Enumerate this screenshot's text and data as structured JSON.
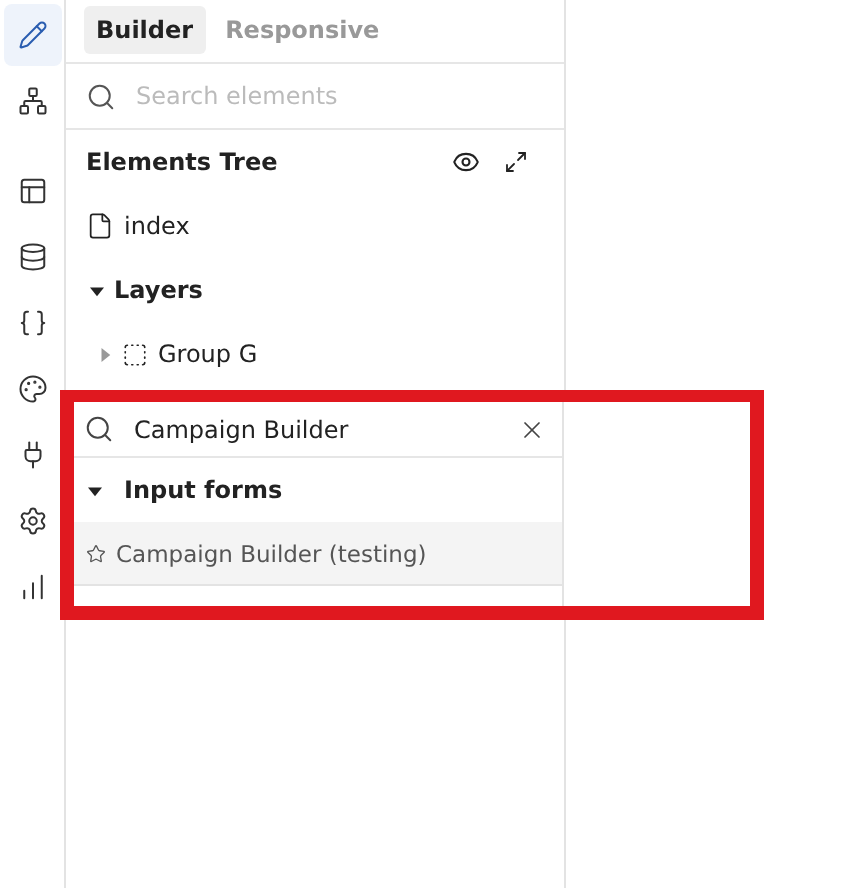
{
  "rail": [
    {
      "kind": "pencil",
      "selected": true
    },
    {
      "kind": "sitemap",
      "selected": false
    },
    {
      "kind": "layout",
      "selected": false
    },
    {
      "kind": "database",
      "selected": false
    },
    {
      "kind": "braces",
      "selected": false
    },
    {
      "kind": "palette",
      "selected": false
    },
    {
      "kind": "plug",
      "selected": false
    },
    {
      "kind": "settings",
      "selected": false
    },
    {
      "kind": "chart",
      "selected": false
    }
  ],
  "tabs": [
    {
      "label": "Builder",
      "selected": true
    },
    {
      "label": "Responsive",
      "selected": false
    }
  ],
  "search": {
    "placeholder": "Search elements"
  },
  "tree": {
    "title": "Elements Tree",
    "page": "index",
    "layers": {
      "label": "Layers",
      "expanded": true,
      "children": [
        {
          "label": "Group G",
          "expanded": false
        }
      ]
    }
  },
  "popup": {
    "query": "Campaign Builder",
    "group": {
      "label": "Input forms",
      "expanded": true,
      "results": [
        {
          "label": "Campaign Builder (testing)",
          "favorite": false
        }
      ]
    }
  }
}
